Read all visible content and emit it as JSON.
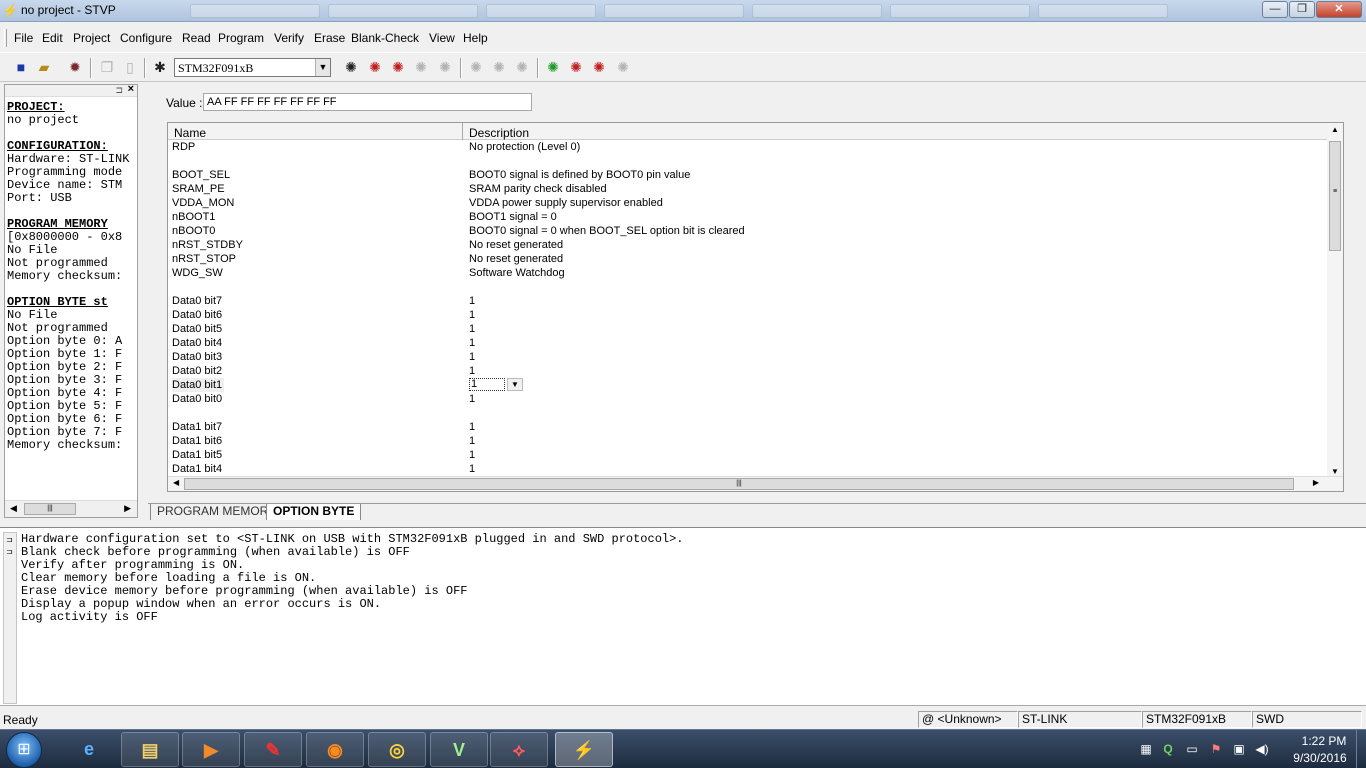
{
  "window": {
    "title": "no project - STVP",
    "min_glyph": "—",
    "max_glyph": "❐",
    "close_glyph": "✕"
  },
  "menu": [
    "File",
    "Edit",
    "Project",
    "Configure",
    "Read",
    "Program",
    "Verify",
    "Erase",
    "Blank-Check",
    "View",
    "Help"
  ],
  "toolbar": {
    "device_value": "STM32F091xB",
    "icons": [
      "save-icon",
      "open-icon",
      "program-project-icon",
      "copy-icon",
      "paste-icon",
      "configure-icon",
      "read-all-icon",
      "read-current-tab-icon",
      "read-option-byte-icon",
      "read-disabled-icon",
      "read-disabled-icon",
      "erase-disabled-icon",
      "erase-disabled-icon",
      "erase-disabled-icon",
      "program-all-icon",
      "program-current-tab-icon",
      "program-option-byte-icon",
      "program-disabled-icon"
    ]
  },
  "left_panel": {
    "lines": [
      {
        "text": "PROJECT:",
        "heading": true
      },
      {
        "text": "no project"
      },
      {
        "text": ""
      },
      {
        "text": "CONFIGURATION:",
        "heading": true
      },
      {
        "text": "Hardware: ST-LINK"
      },
      {
        "text": "Programming mode"
      },
      {
        "text": "Device name: STM"
      },
      {
        "text": "Port: USB"
      },
      {
        "text": ""
      },
      {
        "text": "PROGRAM MEMORY",
        "heading": true
      },
      {
        "text": "[0x8000000 - 0x8"
      },
      {
        "text": "No File"
      },
      {
        "text": "Not programmed"
      },
      {
        "text": "Memory checksum:"
      },
      {
        "text": ""
      },
      {
        "text": "OPTION BYTE st",
        "heading": true
      },
      {
        "text": "No File"
      },
      {
        "text": "Not programmed"
      },
      {
        "text": "Option byte 0: A"
      },
      {
        "text": "Option byte 1: F"
      },
      {
        "text": "Option byte 2: F"
      },
      {
        "text": "Option byte 3: F"
      },
      {
        "text": "Option byte 4: F"
      },
      {
        "text": "Option byte 5: F"
      },
      {
        "text": "Option byte 6: F"
      },
      {
        "text": "Option byte 7: F"
      },
      {
        "text": "Memory checksum:"
      }
    ]
  },
  "value_field": {
    "label": "Value :",
    "value": "AA FF FF FF FF FF FF FF"
  },
  "grid": {
    "headers": {
      "name": "Name",
      "description": "Description"
    },
    "rows": [
      {
        "name": "RDP",
        "desc": "No protection (Level 0)"
      },
      {
        "name": "",
        "desc": ""
      },
      {
        "name": "BOOT_SEL",
        "desc": "BOOT0 signal is defined by BOOT0 pin value"
      },
      {
        "name": "SRAM_PE",
        "desc": "SRAM parity check disabled"
      },
      {
        "name": "VDDA_MON",
        "desc": "VDDA power supply supervisor enabled"
      },
      {
        "name": "nBOOT1",
        "desc": "BOOT1 signal = 0"
      },
      {
        "name": "nBOOT0",
        "desc": "BOOT0 signal = 0 when BOOT_SEL option bit is cleared"
      },
      {
        "name": "nRST_STDBY",
        "desc": "No reset generated"
      },
      {
        "name": "nRST_STOP",
        "desc": "No reset generated"
      },
      {
        "name": "WDG_SW",
        "desc": "Software Watchdog"
      },
      {
        "name": "",
        "desc": ""
      },
      {
        "name": "Data0 bit7",
        "desc": "1"
      },
      {
        "name": "Data0 bit6",
        "desc": "1"
      },
      {
        "name": "Data0 bit5",
        "desc": "1"
      },
      {
        "name": "Data0 bit4",
        "desc": "1"
      },
      {
        "name": "Data0 bit3",
        "desc": "1"
      },
      {
        "name": "Data0 bit2",
        "desc": "1"
      },
      {
        "name": "Data0 bit1",
        "desc": "1",
        "selected": true
      },
      {
        "name": "Data0 bit0",
        "desc": "1"
      },
      {
        "name": "",
        "desc": ""
      },
      {
        "name": "Data1 bit7",
        "desc": "1"
      },
      {
        "name": "Data1 bit6",
        "desc": "1"
      },
      {
        "name": "Data1 bit5",
        "desc": "1"
      },
      {
        "name": "Data1 bit4",
        "desc": "1"
      }
    ]
  },
  "tabs": {
    "program_memory": "PROGRAM MEMORY",
    "option_byte": "OPTION BYTE"
  },
  "log": [
    "Hardware configuration set to <ST-LINK on USB with STM32F091xB plugged in and SWD protocol>.",
    "Blank check before programming (when available) is OFF",
    "Verify after programming is ON.",
    "Clear memory before loading a file is ON.",
    "Erase device memory before programming (when available) is OFF",
    "Display a popup window when an error occurs is ON.",
    "Log activity is OFF"
  ],
  "status": {
    "ready": "Ready",
    "port": "@ <Unknown>",
    "probe": "ST-LINK",
    "device": "STM32F091xB",
    "protocol": "SWD"
  },
  "taskbar": {
    "apps": [
      "internet-explorer-icon",
      "file-explorer-icon",
      "media-player-icon",
      "paint-app-icon",
      "firefox-icon",
      "chrome-icon",
      "stm-studio-icon",
      "acrobat-icon",
      "stvp-app-icon"
    ],
    "clock_time": "1:22 PM",
    "clock_date": "9/30/2016"
  }
}
